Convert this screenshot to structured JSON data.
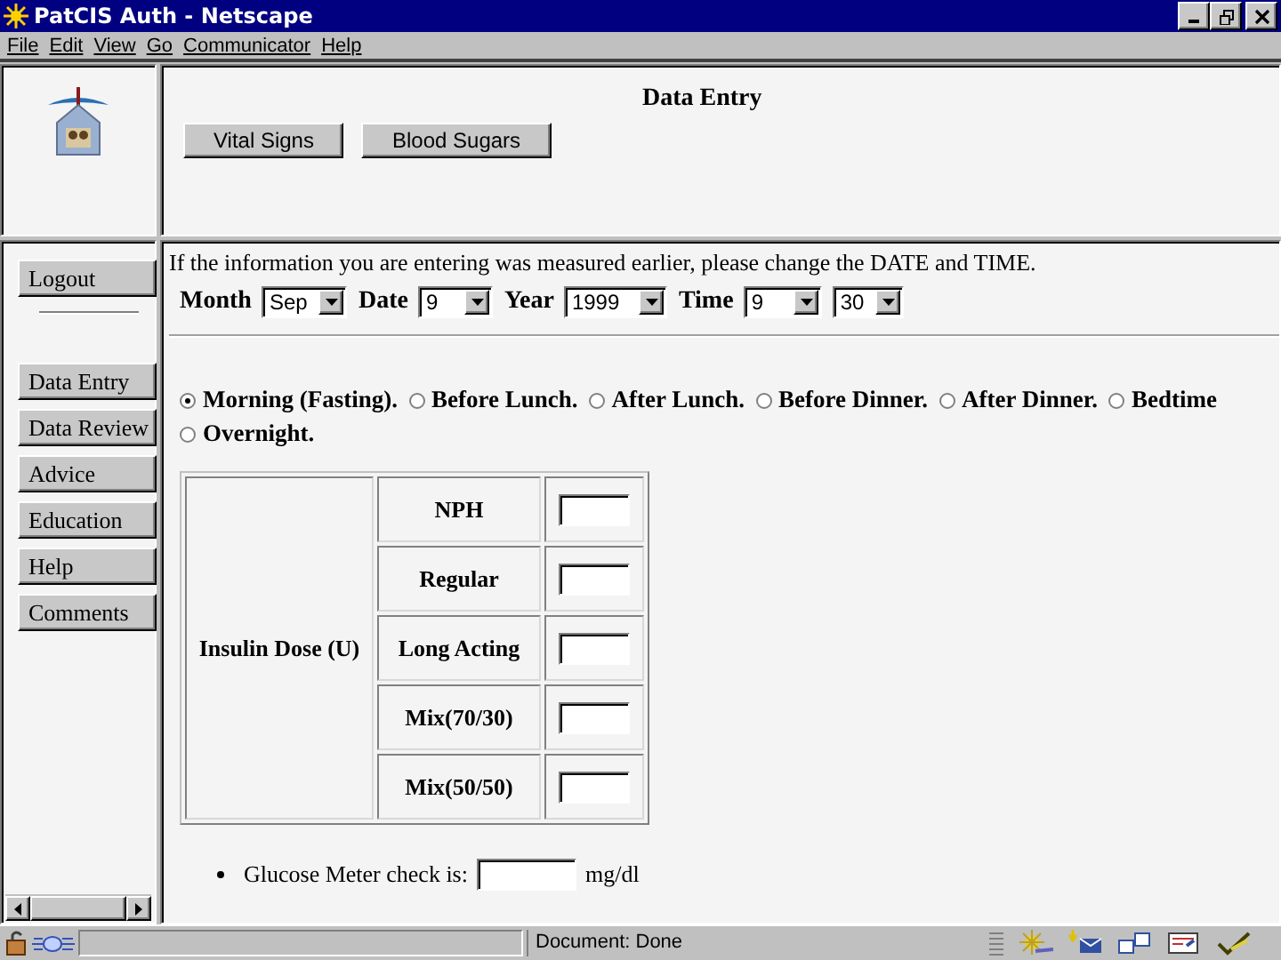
{
  "window": {
    "title": "PatCIS Auth - Netscape"
  },
  "menu": [
    "File",
    "Edit",
    "View",
    "Go",
    "Communicator",
    "Help"
  ],
  "header": {
    "title": "Data Entry",
    "buttons": [
      "Vital Signs",
      "Blood Sugars"
    ]
  },
  "sidebar": {
    "logout": "Logout",
    "nav": [
      "Data Entry",
      "Data Review",
      "Advice",
      "Education",
      "Help",
      "Comments"
    ]
  },
  "instruction": "If the information you are entering was measured earlier, please change the DATE and TIME.",
  "date_fields": [
    {
      "label": "Month",
      "value": "Sep"
    },
    {
      "label": "Date",
      "value": "9"
    },
    {
      "label": "Year",
      "value": "1999"
    },
    {
      "label": "Time",
      "value": "9"
    },
    {
      "value": "30"
    }
  ],
  "meal_times": [
    {
      "label": "Morning (Fasting).",
      "selected": true
    },
    {
      "label": "Before Lunch.",
      "selected": false
    },
    {
      "label": "After Lunch.",
      "selected": false
    },
    {
      "label": "Before Dinner.",
      "selected": false
    },
    {
      "label": "After Dinner.",
      "selected": false
    },
    {
      "label": "Bedtime",
      "selected": false
    },
    {
      "label": "Overnight.",
      "selected": false
    }
  ],
  "insulin": {
    "label": "Insulin Dose (U)",
    "types": [
      "NPH",
      "Regular",
      "Long Acting",
      "Mix(70/30)",
      "Mix(50/50)"
    ]
  },
  "glucose": {
    "label": "Glucose Meter check is:",
    "unit": "mg/dl"
  },
  "status_bar": {
    "text": "Document: Done"
  }
}
